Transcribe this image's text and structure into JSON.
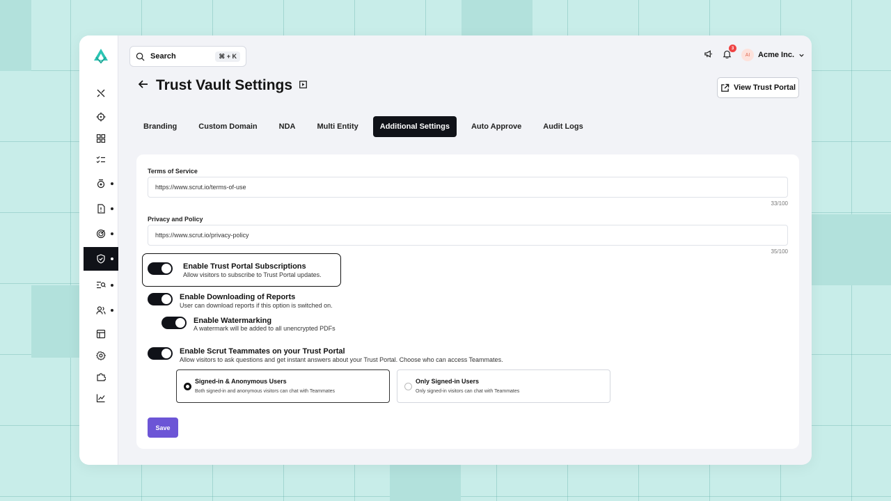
{
  "search": {
    "label": "Search",
    "shortcut": "⌘ + K"
  },
  "header": {
    "notifications_count": "3",
    "avatar_initials": "AI",
    "org_name": "Acme Inc."
  },
  "page": {
    "title": "Trust Vault Settings",
    "view_portal_label": "View Trust Portal"
  },
  "tabs": [
    {
      "label": "Branding"
    },
    {
      "label": "Custom Domain"
    },
    {
      "label": "NDA"
    },
    {
      "label": "Multi Entity"
    },
    {
      "label": "Additional Settings",
      "active": true
    },
    {
      "label": "Auto Approve"
    },
    {
      "label": "Audit Logs"
    }
  ],
  "form": {
    "terms": {
      "label": "Terms of Service",
      "value": "https://www.scrut.io/terms-of-use",
      "counter": "33/100"
    },
    "privacy": {
      "label": "Privacy and Policy",
      "value": "https://www.scrut.io/privacy-policy",
      "counter": "35/100"
    },
    "subscriptions": {
      "title": "Enable Trust Portal Subscriptions",
      "desc": "Allow visitors to subscribe to Trust Portal updates.",
      "enabled": true
    },
    "downloads": {
      "title": "Enable Downloading of Reports",
      "desc": "User can download reports if this option is switched on.",
      "enabled": true
    },
    "watermark": {
      "title": "Enable Watermarking",
      "desc": "A watermark will be added to all unencrypted PDFs",
      "enabled": true
    },
    "teammates": {
      "title": "Enable Scrut Teammates on your Trust Portal",
      "desc": "Allow visitors to ask questions and get instant answers about your Trust Portal. Choose who can access Teammates.",
      "enabled": true
    },
    "access_options": [
      {
        "title": "Signed-in & Anonymous Users",
        "desc": "Both signed-in and anonymous visitors can chat with Teammates",
        "selected": true
      },
      {
        "title": "Only Signed-in Users",
        "desc": "Only signed-in visitors can chat with Teammates",
        "selected": false
      }
    ],
    "save_label": "Save"
  },
  "colors": {
    "accent": "#6c55d6",
    "dark": "#101218",
    "background": "#c8ede9",
    "brand": "#2cc5b4"
  }
}
